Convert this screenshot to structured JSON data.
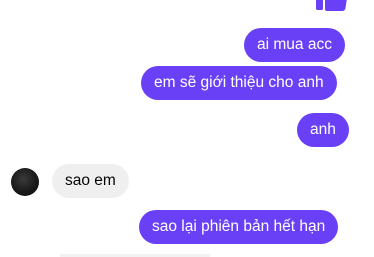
{
  "messages": [
    {
      "direction": "outgoing",
      "text": "ai mua acc"
    },
    {
      "direction": "outgoing",
      "text": "em sẽ giới thiệu cho anh"
    },
    {
      "direction": "outgoing",
      "text": "anh"
    },
    {
      "direction": "incoming",
      "text": "sao em"
    },
    {
      "direction": "outgoing",
      "text": "sao lại phiên bản hết hạn"
    }
  ],
  "colors": {
    "outgoing_bubble": "#6a40f6",
    "incoming_bubble": "#efefef",
    "like_icon": "#6a40f6"
  },
  "icons": {
    "top_reaction": "thumbs-up-icon",
    "contact_avatar": "avatar"
  }
}
